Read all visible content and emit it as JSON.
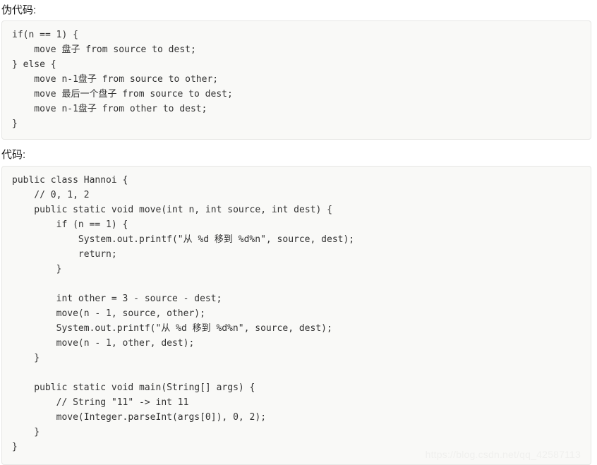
{
  "sections": [
    {
      "label": "伪代码:",
      "language": "pseudocode",
      "lines": [
        "if(n == 1) {",
        "    move 盘子 from source to dest;",
        "} else {",
        "    move n-1盘子 from source to other;",
        "    move 最后一个盘子 from source to dest;",
        "    move n-1盘子 from other to dest;",
        "}"
      ]
    },
    {
      "label": "代码:",
      "language": "java",
      "lines": [
        "public class Hannoi {",
        "    // 0, 1, 2",
        "    public static void move(int n, int source, int dest) {",
        "        if (n == 1) {",
        "            System.out.printf(\"从 %d 移到 %d%n\", source, dest);",
        "            return;",
        "        }",
        "",
        "        int other = 3 - source - dest;",
        "        move(n - 1, source, other);",
        "        System.out.printf(\"从 %d 移到 %d%n\", source, dest);",
        "        move(n - 1, other, dest);",
        "    }",
        "",
        "    public static void main(String[] args) {",
        "        // String \"11\" -> int 11",
        "        move(Integer.parseInt(args[0]), 0, 2);",
        "    }",
        "}"
      ]
    }
  ],
  "watermark": {
    "text": "https://blog.csdn.net/qq_42587113"
  },
  "colors": {
    "page_background": "#ffffff",
    "code_background": "#f9f9f7",
    "code_border": "#e7e7e5",
    "code_text": "#333333",
    "label_text": "#1a1a1a",
    "watermark_text": "#f0f0ee"
  }
}
